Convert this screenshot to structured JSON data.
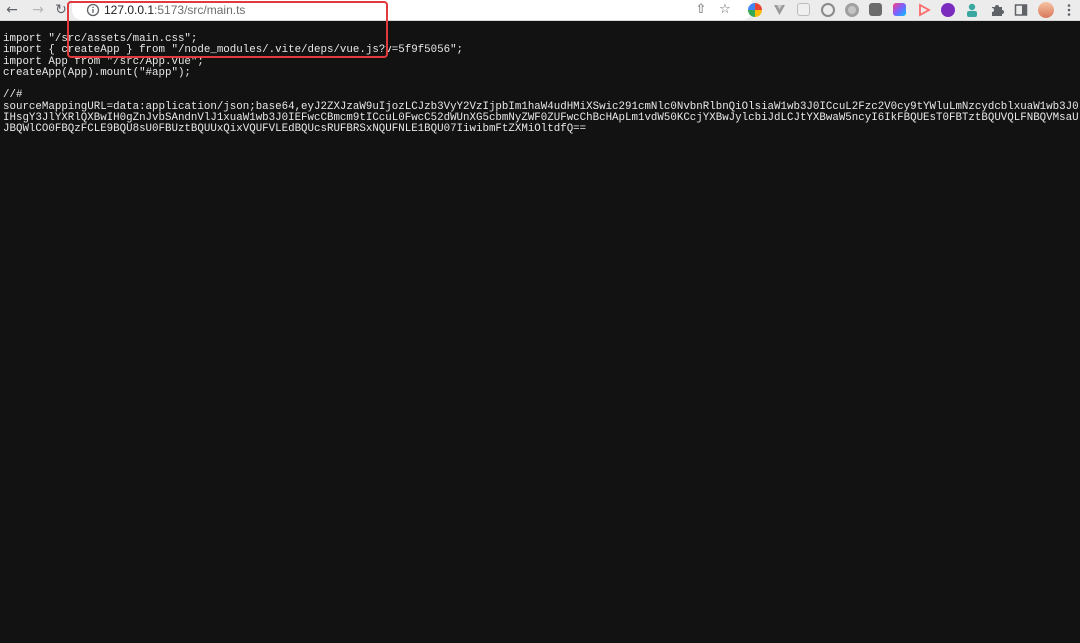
{
  "browser": {
    "url": {
      "host": "127.0.0.1",
      "path": ":5173/src/main.ts"
    },
    "nav_icons": [
      "back-arrow-icon",
      "forward-arrow-icon",
      "reload-icon"
    ],
    "omnibox_actions": [
      "share-icon",
      "bookmark-star-icon"
    ],
    "extensions": [
      {
        "name": "extension-globe-icon",
        "color": "#3b82f6"
      },
      {
        "name": "extension-vue-devtools-icon",
        "color": "#9a9a9a"
      },
      {
        "name": "extension-square-icon",
        "color": "#bdbdbd"
      },
      {
        "name": "extension-circle-icon",
        "color": "#8a8a8a"
      },
      {
        "name": "extension-gear-icon",
        "color": "#a0a0a0"
      },
      {
        "name": "extension-download-icon",
        "color": "#6b6b6b"
      },
      {
        "name": "extension-color-icon",
        "color": "#e54b8a"
      },
      {
        "name": "extension-arrow-icon",
        "color": "#ff6a6a"
      },
      {
        "name": "extension-purple-icon",
        "color": "#7b2cbf"
      },
      {
        "name": "extension-person-icon",
        "color": "#3aa7a0"
      }
    ],
    "toolbar_icons": [
      "puzzle-icon",
      "sidebar-icon",
      "avatar",
      "menu-dots-icon"
    ]
  },
  "code": {
    "lines": [
      "import \"/src/assets/main.css\";",
      "import { createApp } from \"/node_modules/.vite/deps/vue.js?v=5f9f5056\";",
      "import App from \"/src/App.vue\";",
      "createApp(App).mount(\"#app\");"
    ],
    "comment": "//#",
    "sourcemap": "sourceMappingURL=data:application/json;base64,eyJ2ZXJzaW9uIjozLCJzb3VyY2VzIjpbIm1haW4udHMiXSwic291cmNlc0NvbnRlbnQiOlsiaW1wb3J0ICcuL2Fzc2V0cy9tYWluLmNzcydcblxuaW1wb3J0IHsgY3JlYXRlQXBwIH0gZnJvbSAndnVlJ1xuaW1wb3J0IEFwcCBmcm9tICcuL0FwcC52dWUnXG5cbmNyZWF0ZUFwcChBcHApLm1vdW50KCcjYXBwJylcbiJdLCJtYXBwaW5ncyI6IkFBQUEsT0FBTztBQUVQLFNBQVMsaUJBQWlCO0FBQzFCLE9BQU8sU0FBUztBQUUxQixVQUFVLEdBQUcsRUFBRSxNQUFNLE1BQU07IiwibmFtZXMiOltdfQ=="
  }
}
